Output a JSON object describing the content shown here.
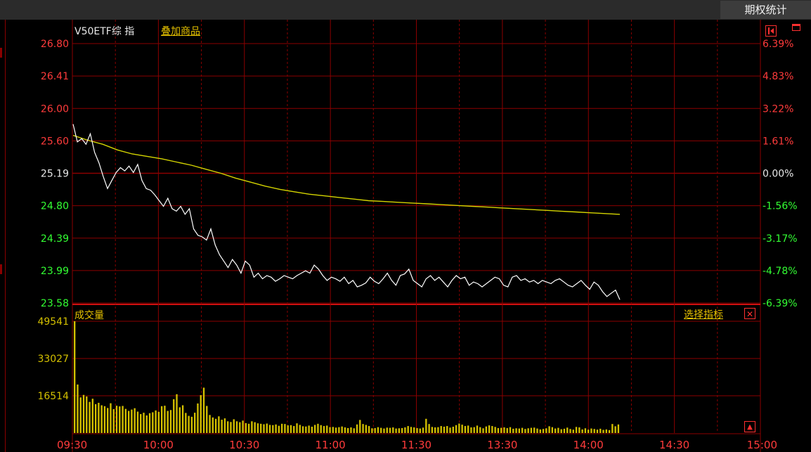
{
  "toolbar": {
    "tab": "期权统计"
  },
  "chart_header": {
    "title": "V50ETF综 指",
    "overlay_link": "叠加商品"
  },
  "volume_header": {
    "title": "成交量",
    "select_indicator": "选择指标",
    "close_glyph": "✕",
    "expand_glyph": "▲"
  },
  "colors": {
    "up": "#ff3b3b",
    "down": "#33ff33",
    "price_line": "#ffffff",
    "avg_line": "#d4d400",
    "grid": "#8b0000",
    "volume_bar": "#d4c000"
  },
  "chart_data": {
    "type": "line",
    "x_ticks": [
      "09:30",
      "10:00",
      "10:30",
      "11:00",
      "11:30",
      "13:30",
      "14:00",
      "14:30",
      "15:00"
    ],
    "price_ticks": [
      "26.80",
      "26.41",
      "26.00",
      "25.60",
      "25.19",
      "24.80",
      "24.39",
      "23.99",
      "23.58"
    ],
    "pct_ticks": [
      "6.39%",
      "4.83%",
      "3.22%",
      "1.61%",
      "0.00%",
      "-1.56%",
      "-3.17%",
      "-4.78%",
      "-6.39%"
    ],
    "prev_close": 25.19,
    "ylim": [
      23.58,
      26.8
    ],
    "series": [
      {
        "key": "price",
        "values": [
          25.8,
          25.58,
          25.62,
          25.55,
          25.68,
          25.45,
          25.32,
          25.15,
          25.0,
          25.1,
          25.2,
          25.26,
          25.22,
          25.28,
          25.2,
          25.3,
          25.1,
          25.0,
          24.98,
          24.92,
          24.85,
          24.78,
          24.88,
          24.75,
          24.72,
          24.78,
          24.68,
          24.75,
          24.5,
          24.42,
          24.4,
          24.36,
          24.5,
          24.3,
          24.18,
          24.1,
          24.02,
          24.12,
          24.05,
          23.95,
          24.1,
          24.05,
          23.9,
          23.95,
          23.88,
          23.92,
          23.9,
          23.85,
          23.88,
          23.92,
          23.9,
          23.88,
          23.92,
          23.95,
          23.98,
          23.95,
          24.05,
          24.0,
          23.92,
          23.86,
          23.9,
          23.88,
          23.85,
          23.9,
          23.82,
          23.86,
          23.78,
          23.8,
          23.83,
          23.9,
          23.85,
          23.82,
          23.88,
          23.95,
          23.86,
          23.8,
          23.92,
          23.94,
          24.0,
          23.86,
          23.82,
          23.78,
          23.88,
          23.92,
          23.86,
          23.9,
          23.84,
          23.78,
          23.86,
          23.92,
          23.88,
          23.9,
          23.8,
          23.84,
          23.82,
          23.78,
          23.82,
          23.86,
          23.9,
          23.88,
          23.8,
          23.78,
          23.9,
          23.92,
          23.86,
          23.88,
          23.84,
          23.86,
          23.82,
          23.86,
          23.84,
          23.82,
          23.86,
          23.88,
          23.84,
          23.8,
          23.78,
          23.82,
          23.86,
          23.8,
          23.75,
          23.84,
          23.8,
          23.72,
          23.66,
          23.7,
          23.74,
          23.62
        ]
      },
      {
        "key": "average",
        "values": [
          25.66,
          25.6,
          25.55,
          25.48,
          25.43,
          25.4,
          25.37,
          25.33,
          25.29,
          25.24,
          25.19,
          25.13,
          25.08,
          25.03,
          24.99,
          24.96,
          24.93,
          24.91,
          24.89,
          24.87,
          24.85,
          24.84,
          24.83,
          24.82,
          24.81,
          24.8,
          24.79,
          24.78,
          24.77,
          24.76,
          24.75,
          24.74,
          24.73,
          24.72,
          24.71,
          24.7,
          24.69,
          24.68
        ]
      }
    ],
    "volume": {
      "ticks": [
        "49541",
        "33027",
        "16514"
      ],
      "ylim": [
        0,
        49541
      ],
      "values": [
        49541,
        21500,
        15800,
        16900,
        16200,
        13800,
        15200,
        12800,
        13400,
        12300,
        11900,
        11100,
        13200,
        10600,
        12100,
        11800,
        12000,
        10700,
        9800,
        10400,
        11000,
        9500,
        8400,
        9000,
        7800,
        8800,
        9200,
        10000,
        9400,
        11900,
        12100,
        9800,
        10200,
        15000,
        17200,
        11400,
        12300,
        8900,
        7600,
        7200,
        9000,
        13100,
        16800,
        20100,
        12000,
        8000,
        6900,
        6300,
        7400,
        5900,
        6500,
        5200,
        4900,
        6100,
        5200,
        4800,
        5500,
        4400,
        4100,
        5200,
        4800,
        4300,
        4100,
        3900,
        4200,
        3600,
        3500,
        3800,
        3200,
        4100,
        4000,
        3400,
        3500,
        3100,
        4300,
        3600,
        3000,
        2900,
        3300,
        2800,
        3600,
        4100,
        3500,
        3100,
        3300,
        2600,
        2700,
        2400,
        2600,
        2900,
        2500,
        2200,
        2500,
        2100,
        3800,
        5800,
        4000,
        3600,
        3100,
        2100,
        2200,
        2600,
        2300,
        2000,
        2400,
        2300,
        2500,
        2000,
        2100,
        2200,
        2500,
        3100,
        2700,
        2500,
        2200,
        2000,
        2400,
        6300,
        4000,
        2700,
        2500,
        2600,
        3100,
        2800,
        3100,
        2400,
        2800,
        3500,
        4200,
        3700,
        3100,
        3300,
        2500,
        2600,
        3300,
        2600,
        2100,
        2900,
        3400,
        3100,
        2700,
        2200,
        2300,
        2500,
        2200,
        2600,
        1900,
        2100,
        2000,
        2300,
        1800,
        2100,
        2300,
        2400,
        2000,
        1600,
        1800,
        2100,
        3000,
        2600,
        2000,
        2300,
        1700,
        1900,
        2400,
        1800,
        1500,
        2700,
        2500,
        1600,
        2100,
        1500,
        2000,
        1800,
        1500,
        1900,
        1400,
        1600,
        1300,
        4000,
        3000,
        3800
      ]
    }
  }
}
